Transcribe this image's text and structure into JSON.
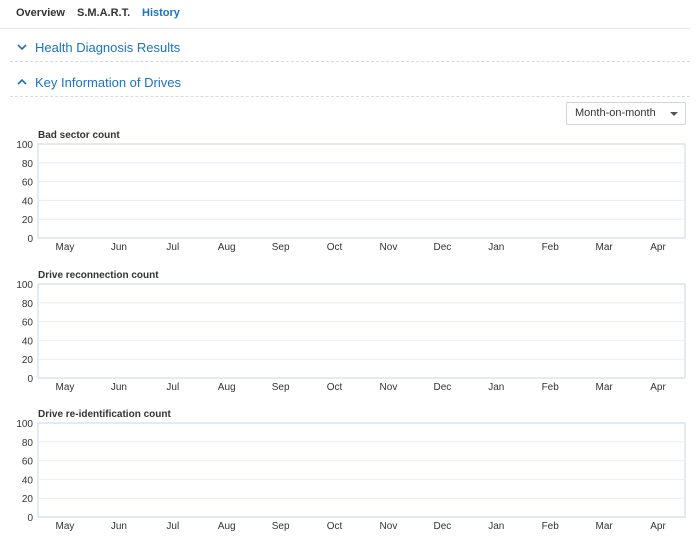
{
  "tabs": [
    {
      "label": "Overview",
      "active": false
    },
    {
      "label": "S.M.A.R.T.",
      "active": false
    },
    {
      "label": "History",
      "active": true
    }
  ],
  "sections": {
    "health": {
      "title": "Health Diagnosis Results",
      "expanded": false
    },
    "key_info": {
      "title": "Key Information of Drives",
      "expanded": true
    }
  },
  "period_select": {
    "value": "Month-on-month"
  },
  "colors": {
    "accent": "#1a73c7",
    "grid": "#e8eef6",
    "axis": "#c9d6e6"
  },
  "chart_data": [
    {
      "type": "line",
      "title": "Bad sector count",
      "categories": [
        "May",
        "Jun",
        "Jul",
        "Aug",
        "Sep",
        "Oct",
        "Nov",
        "Dec",
        "Jan",
        "Feb",
        "Mar",
        "Apr"
      ],
      "series": [],
      "ylim": [
        0,
        100
      ],
      "yticks": [
        "100",
        "80",
        "60",
        "40",
        "20",
        "0"
      ],
      "grid": true
    },
    {
      "type": "line",
      "title": "Drive reconnection count",
      "categories": [
        "May",
        "Jun",
        "Jul",
        "Aug",
        "Sep",
        "Oct",
        "Nov",
        "Dec",
        "Jan",
        "Feb",
        "Mar",
        "Apr"
      ],
      "series": [],
      "ylim": [
        0,
        100
      ],
      "yticks": [
        "100",
        "80",
        "60",
        "40",
        "20",
        "0"
      ],
      "grid": true
    },
    {
      "type": "line",
      "title": "Drive re-identification count",
      "categories": [
        "May",
        "Jun",
        "Jul",
        "Aug",
        "Sep",
        "Oct",
        "Nov",
        "Dec",
        "Jan",
        "Feb",
        "Mar",
        "Apr"
      ],
      "series": [],
      "ylim": [
        0,
        100
      ],
      "yticks": [
        "100",
        "80",
        "60",
        "40",
        "20",
        "0"
      ],
      "grid": true
    }
  ]
}
